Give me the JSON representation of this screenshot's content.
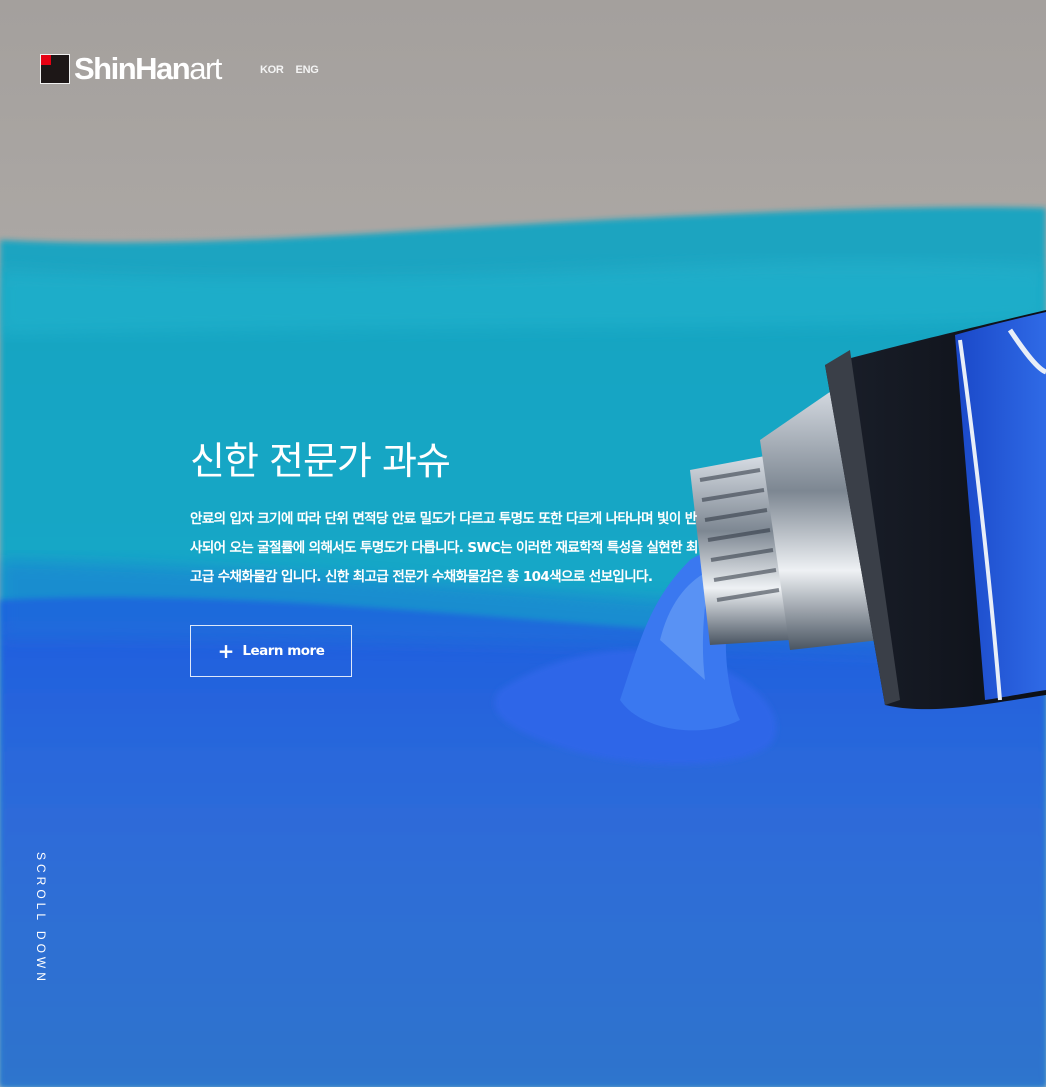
{
  "brand": {
    "name_bold": "ShinHan",
    "name_light": "art"
  },
  "lang": {
    "kor": "KOR",
    "eng": "ENG"
  },
  "hero": {
    "title": "신한 전문가 과슈",
    "desc_lines": [
      "안료의 입자 크기에 따라 단위 면적당 안료 밀도가 다르고 투명도 또한 다르게 나타나며 빛이 반",
      "사되어 오는 굴절률에 의해서도 투명도가 다릅니다. SWC는 이러한 재료학적 특성을 실현한 최",
      "고급 수채화물감 입니다. 신한 최고급 전문가 수채화물감은 총 104색으로 선보입니다."
    ],
    "button_icon": "+",
    "button_label": "Learn more"
  },
  "scroll_label": "SCROLL DOWN",
  "colors": {
    "accent_red": "#e60012",
    "paint_blue": "#2f6fd4",
    "paint_cyan": "#18a6c6",
    "backdrop_gray": "#b9b6b3"
  }
}
